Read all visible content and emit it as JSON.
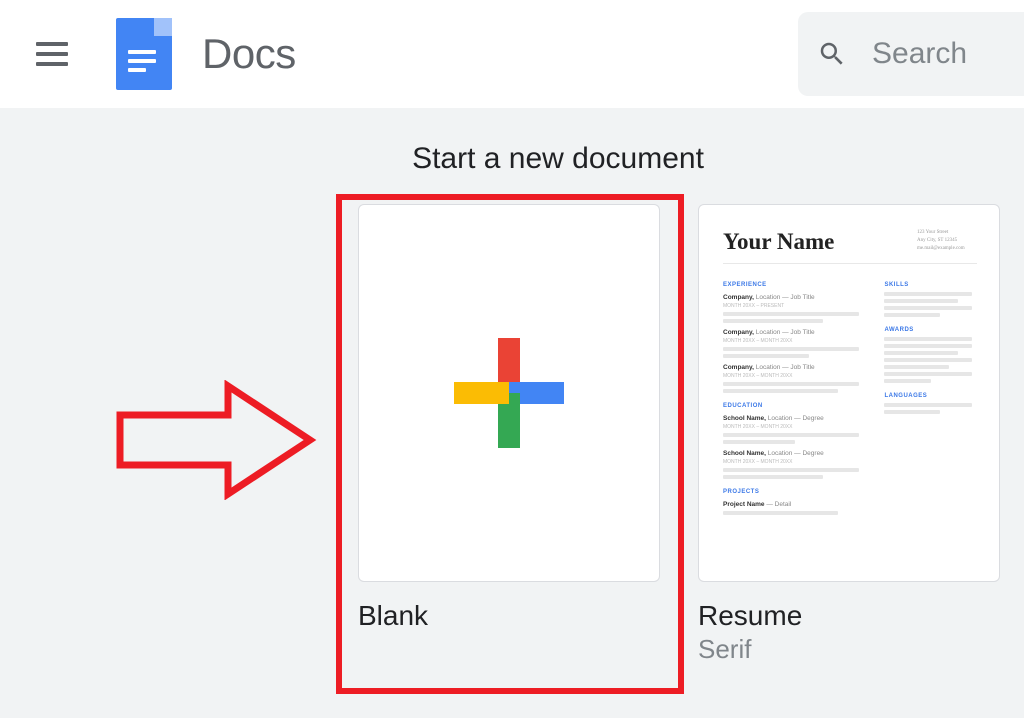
{
  "header": {
    "app_title": "Docs",
    "search_placeholder": "Search"
  },
  "section": {
    "title": "Start a new document"
  },
  "templates": [
    {
      "id": "blank",
      "label": "Blank",
      "subtitle": ""
    },
    {
      "id": "resume",
      "label": "Resume",
      "subtitle": "Serif"
    }
  ],
  "resume_preview": {
    "name": "Your Name",
    "sections_left": [
      "EXPERIENCE",
      "EDUCATION",
      "PROJECTS"
    ],
    "sections_right": [
      "SKILLS",
      "AWARDS",
      "LANGUAGES"
    ]
  },
  "annotation": {
    "highlight_target": "blank",
    "arrow_points_to": "blank"
  },
  "colors": {
    "accent": "#4285f4",
    "google_red": "#ea4335",
    "google_yellow": "#fbbc04",
    "google_green": "#34a853",
    "annotation_red": "#ed1c24"
  }
}
